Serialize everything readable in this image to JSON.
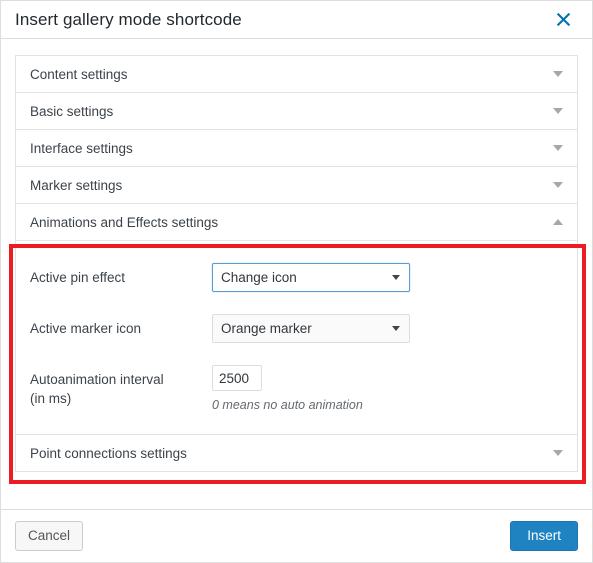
{
  "dialog": {
    "title": "Insert gallery mode shortcode",
    "close_icon": "close-icon"
  },
  "accordion": {
    "sections": [
      {
        "label": "Content settings",
        "expanded": false
      },
      {
        "label": "Basic settings",
        "expanded": false
      },
      {
        "label": "Interface settings",
        "expanded": false
      },
      {
        "label": "Marker settings",
        "expanded": false
      },
      {
        "label": "Animations and Effects settings",
        "expanded": true
      },
      {
        "label": "Point connections settings",
        "expanded": false
      }
    ]
  },
  "animations_panel": {
    "fields": {
      "active_pin_effect": {
        "label": "Active pin effect",
        "value": "Change icon",
        "focused": true
      },
      "active_marker_icon": {
        "label": "Active marker icon",
        "value": "Orange marker",
        "focused": false
      },
      "autoanimation_interval": {
        "label": "Autoanimation interval (in ms)",
        "label_line1": "Autoanimation interval",
        "label_line2": "(in ms)",
        "value": "2500",
        "hint": "0 means no auto animation"
      }
    }
  },
  "footer": {
    "cancel_label": "Cancel",
    "insert_label": "Insert"
  },
  "colors": {
    "highlight": "#ec1c24",
    "primary": "#1e83c0",
    "link": "#0073aa",
    "focus_border": "#5b9dd9"
  }
}
